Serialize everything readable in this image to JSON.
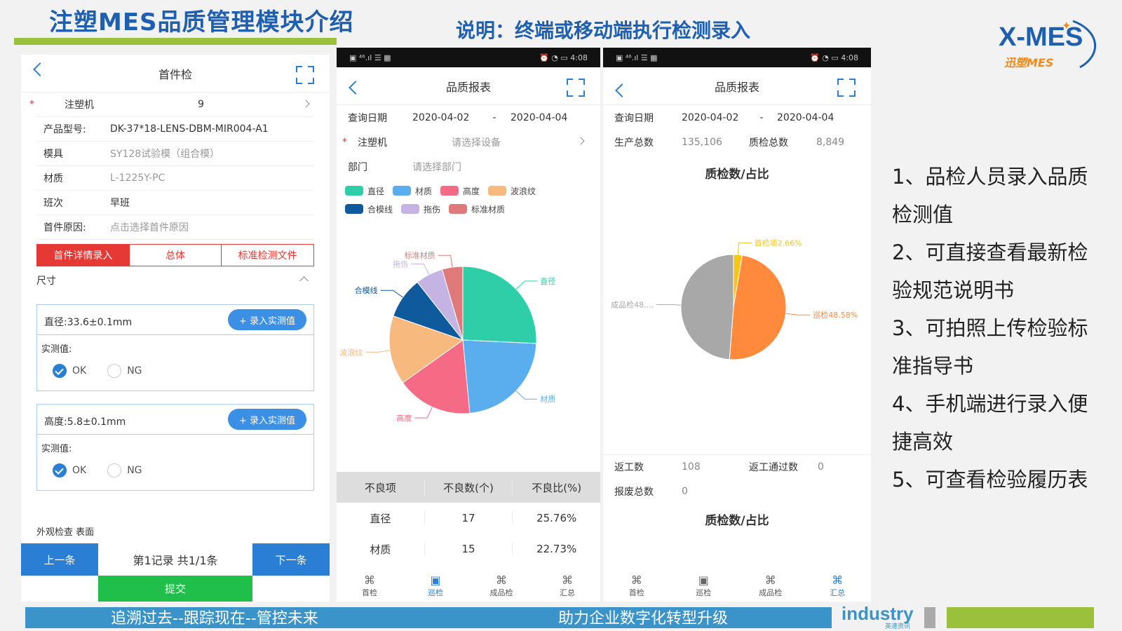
{
  "slide": {
    "title": "注塑MES品质管理模块介绍",
    "subtitle": "说明：终端或移动端执行检测录入",
    "logo": {
      "main": "X-MES",
      "sub": "迅塑MES"
    },
    "points": [
      "1、品检人员录入品质检测值",
      "2、可直接查看最新检验规范说明书",
      "3、可拍照上传检验标准指导书",
      "4、手机端进行录入便捷高效",
      "5、可查看检验履历表"
    ],
    "footer": {
      "left": "追溯过去--跟踪现在--管控未来",
      "right": "助力企业数字化转型升级",
      "brand": "industry",
      "brand_sub": "英速资讯"
    }
  },
  "phone1": {
    "title": "首件检",
    "fields": [
      {
        "label": "注塑机",
        "value": "9",
        "required": true
      },
      {
        "label": "产品型号:",
        "value": "DK-37*18-LENS-DBM-MIR004-A1"
      },
      {
        "label": "模具",
        "value": "SY128试验模（组合模）"
      },
      {
        "label": "材质",
        "value": "L-1225Y-PC"
      },
      {
        "label": "班次",
        "value": "早班"
      },
      {
        "label": "首件原因:",
        "value": "点击选择首件原因"
      }
    ],
    "tabs": [
      "首件详情录入",
      "总体",
      "标准检测文件"
    ],
    "section": "尺寸",
    "cards": [
      {
        "title": "直径:33.6±0.1mm",
        "add": "+ 录入实测值",
        "measured_label": "实测值:",
        "ok": "OK",
        "ng": "NG"
      },
      {
        "title": "高度:5.8±0.1mm",
        "add": "+ 录入实测值",
        "measured_label": "实测值:",
        "ok": "OK",
        "ng": "NG"
      }
    ],
    "clipped_text": "外观检查   表面",
    "prev": "上一条",
    "record": "第1记录   共1/1条",
    "next": "下一条",
    "submit": "提交"
  },
  "phone2": {
    "status_time": "4:08",
    "title": "品质报表",
    "query_label": "查询日期",
    "date_from": "2020-04-02",
    "dash": "-",
    "date_to": "2020-04-04",
    "machine_label": "注塑机",
    "machine_placeholder": "请选择设备",
    "dept_label": "部门",
    "dept_placeholder": "请选择部门",
    "table_header": [
      "不良项",
      "不良数(个)",
      "不良比(%)"
    ],
    "table_rows": [
      [
        "直径",
        "17",
        "25.76%"
      ],
      [
        "材质",
        "15",
        "22.73%"
      ]
    ],
    "tabs": [
      "首检",
      "巡检",
      "成品检",
      "汇总"
    ]
  },
  "phone3": {
    "status_time": "4:08",
    "title": "品质报表",
    "query_label": "查询日期",
    "date_from": "2020-04-02",
    "dash": "-",
    "date_to": "2020-04-04",
    "prod_total_label": "生产总数",
    "prod_total": "135,106",
    "qc_total_label": "质检总数",
    "qc_total": "8,849",
    "chart_title": "质检数/占比",
    "rework_label": "返工数",
    "rework": "108",
    "rework_pass_label": "返工通过数",
    "rework_pass": "0",
    "scrap_label": "报废总数",
    "scrap": "0",
    "chart_title2": "质检数/占比",
    "tabs": [
      "首检",
      "巡检",
      "成品检",
      "汇总"
    ]
  },
  "chart_data": [
    {
      "type": "pie",
      "title": "",
      "slices": [
        {
          "name": "直径",
          "value": 25.76,
          "color": "#2ecfa8"
        },
        {
          "name": "材质",
          "value": 22.73,
          "color": "#5aaeed"
        },
        {
          "name": "高度",
          "value": 16.67,
          "color": "#f56b85"
        },
        {
          "name": "波浪纹",
          "value": 15.15,
          "color": "#f8b97e"
        },
        {
          "name": "合模线",
          "value": 9.09,
          "color": "#0e5a9c"
        },
        {
          "name": "拖伤",
          "value": 6.06,
          "color": "#c4b3e3"
        },
        {
          "name": "标准材质",
          "value": 4.54,
          "color": "#e07a7a"
        }
      ],
      "legend": "top"
    },
    {
      "type": "pie",
      "title": "质检数/占比",
      "slices": [
        {
          "name": "首检项2.66%",
          "value": 2.66,
          "color": "#f5c518"
        },
        {
          "name": "巡检48.58%",
          "value": 48.58,
          "color": "#ff8a3c"
        },
        {
          "name": "成品检48....",
          "value": 48.76,
          "color": "#a8a8a8"
        }
      ]
    }
  ]
}
